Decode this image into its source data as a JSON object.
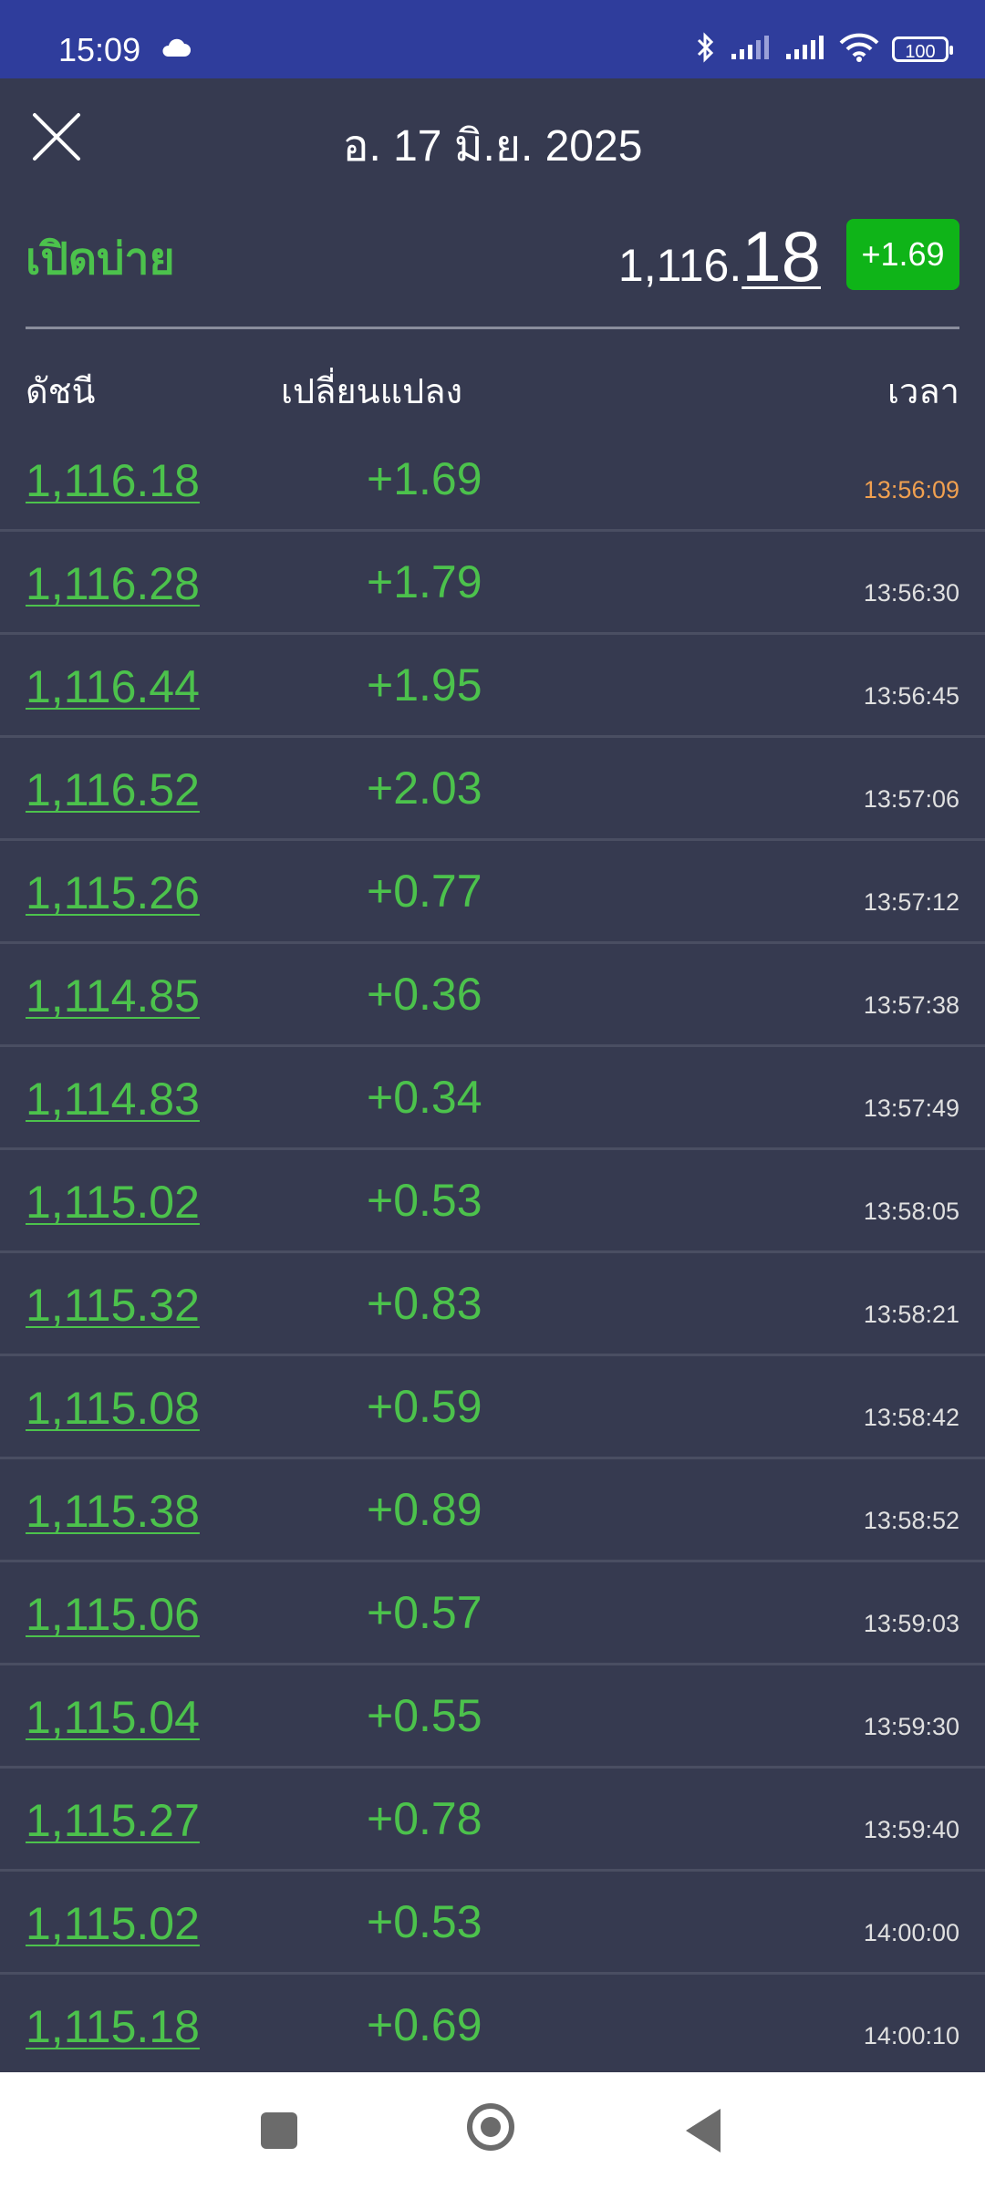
{
  "status_bar": {
    "time": "15:09",
    "battery": "100",
    "icons": [
      "cloud-icon",
      "bluetooth-icon",
      "signal-icon",
      "signal-icon",
      "wifi-icon",
      "battery-icon"
    ]
  },
  "header": {
    "date": "อ. 17 มิ.ย. 2025",
    "close_icon": "close-icon"
  },
  "summary": {
    "status": "เปิดบ่าย",
    "index_int": "1,116.",
    "index_dec": "18",
    "change": "+1.69"
  },
  "table": {
    "columns": [
      "ดัชนี",
      "เปลี่ยนแปลง",
      "เวลา"
    ],
    "rows": [
      {
        "index": "1,116.18",
        "change": "+1.69",
        "time": "13:56:09"
      },
      {
        "index": "1,116.28",
        "change": "+1.79",
        "time": "13:56:30"
      },
      {
        "index": "1,116.44",
        "change": "+1.95",
        "time": "13:56:45"
      },
      {
        "index": "1,116.52",
        "change": "+2.03",
        "time": "13:57:06"
      },
      {
        "index": "1,115.26",
        "change": "+0.77",
        "time": "13:57:12"
      },
      {
        "index": "1,114.85",
        "change": "+0.36",
        "time": "13:57:38"
      },
      {
        "index": "1,114.83",
        "change": "+0.34",
        "time": "13:57:49"
      },
      {
        "index": "1,115.02",
        "change": "+0.53",
        "time": "13:58:05"
      },
      {
        "index": "1,115.32",
        "change": "+0.83",
        "time": "13:58:21"
      },
      {
        "index": "1,115.08",
        "change": "+0.59",
        "time": "13:58:42"
      },
      {
        "index": "1,115.38",
        "change": "+0.89",
        "time": "13:58:52"
      },
      {
        "index": "1,115.06",
        "change": "+0.57",
        "time": "13:59:03"
      },
      {
        "index": "1,115.04",
        "change": "+0.55",
        "time": "13:59:30"
      },
      {
        "index": "1,115.27",
        "change": "+0.78",
        "time": "13:59:40"
      },
      {
        "index": "1,115.02",
        "change": "+0.53",
        "time": "14:00:00"
      },
      {
        "index": "1,115.18",
        "change": "+0.69",
        "time": "14:00:10"
      }
    ]
  },
  "colors": {
    "background": "#363a50",
    "status_bar": "#2f3d9c",
    "positive": "#4cc24c",
    "badge": "#0fb418",
    "latest_time": "#f0a050"
  },
  "nav": {
    "icons": [
      "recent-apps-icon",
      "home-icon",
      "back-icon"
    ]
  }
}
